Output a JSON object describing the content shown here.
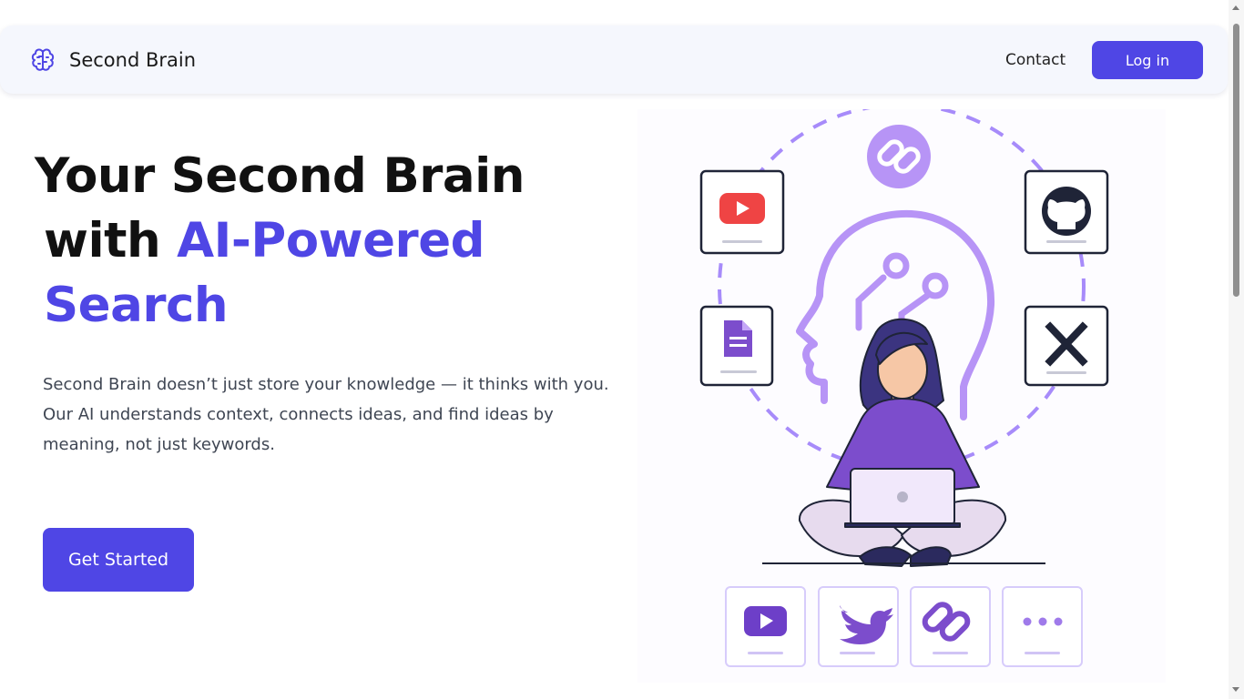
{
  "nav": {
    "brand": "Second Brain",
    "contact": "Contact",
    "login": "Log in"
  },
  "hero": {
    "title_line1": "Your Second Brain",
    "title_with": "with",
    "title_accent": "AI-Powered",
    "title_line3": "Search",
    "description": "Second Brain doesn’t just store your knowledge — it thinks with you. Our AI understands context, connects ideas, and find ideas by meaning, not just keywords.",
    "cta": "Get Started"
  },
  "illustration": {
    "top_cards": [
      "youtube-icon",
      "github-icon",
      "document-icon",
      "x-logo-icon"
    ],
    "bottom_cards": [
      "youtube-icon",
      "twitter-icon",
      "link-icon",
      "more-icon"
    ]
  },
  "colors": {
    "accent": "#4f46e5",
    "accent_light": "#a78bfa",
    "navbar_bg": "#f5f7fd"
  }
}
